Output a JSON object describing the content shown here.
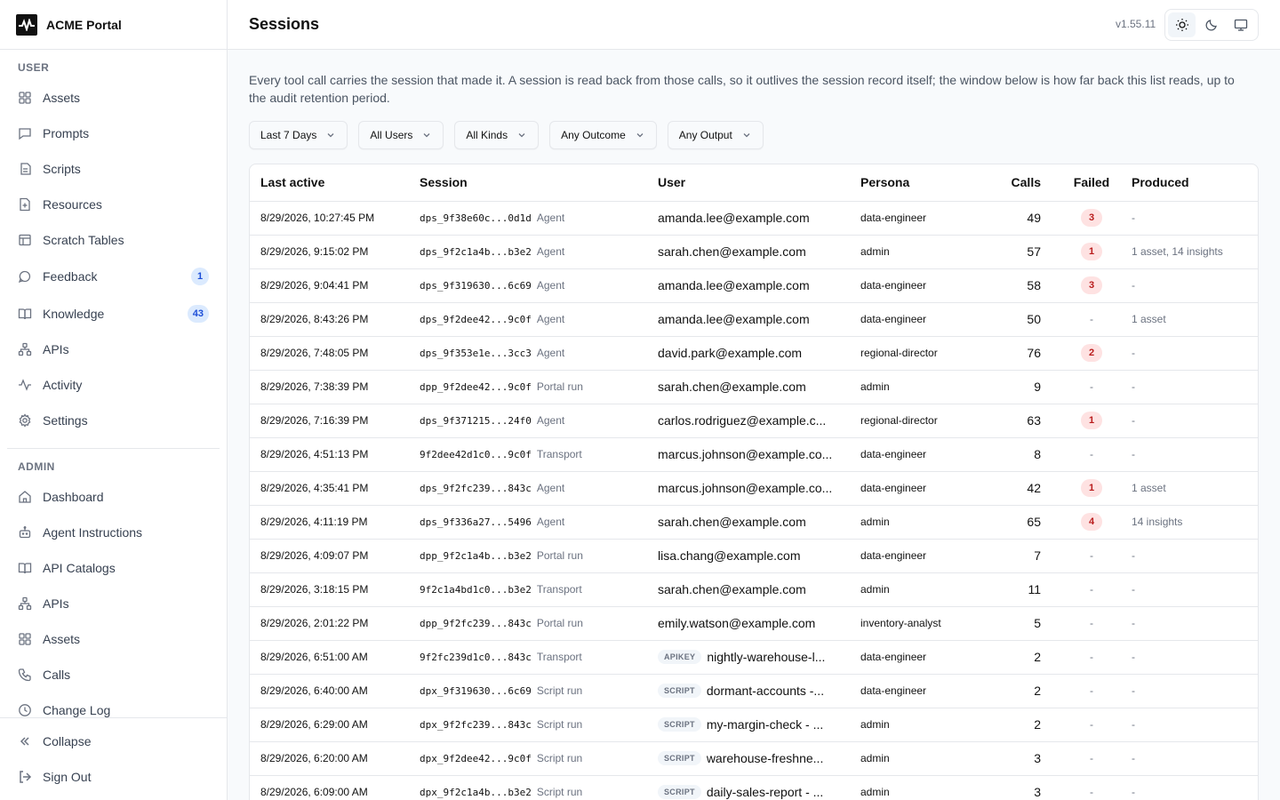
{
  "app": {
    "name": "ACME Portal",
    "version": "v1.55.11"
  },
  "sidebar": {
    "user_section": "USER",
    "admin_section": "ADMIN",
    "user_items": [
      {
        "label": "Assets",
        "icon": "grid-icon"
      },
      {
        "label": "Prompts",
        "icon": "message-square-icon"
      },
      {
        "label": "Scripts",
        "icon": "script-icon"
      },
      {
        "label": "Resources",
        "icon": "file-plus-icon"
      },
      {
        "label": "Scratch Tables",
        "icon": "table-icon"
      },
      {
        "label": "Feedback",
        "icon": "message-circle-icon",
        "badge": "1"
      },
      {
        "label": "Knowledge",
        "icon": "book-open-icon",
        "badge": "43"
      },
      {
        "label": "APIs",
        "icon": "network-icon"
      },
      {
        "label": "Activity",
        "icon": "activity-icon"
      },
      {
        "label": "Settings",
        "icon": "gear-icon"
      }
    ],
    "admin_items": [
      {
        "label": "Dashboard",
        "icon": "home-icon"
      },
      {
        "label": "Agent Instructions",
        "icon": "bot-icon"
      },
      {
        "label": "API Catalogs",
        "icon": "book-open-icon"
      },
      {
        "label": "APIs",
        "icon": "network-icon"
      },
      {
        "label": "Assets",
        "icon": "grid-icon"
      },
      {
        "label": "Calls",
        "icon": "phone-icon"
      },
      {
        "label": "Change Log",
        "icon": "clock-icon"
      }
    ],
    "footer": {
      "collapse": "Collapse",
      "sign_out": "Sign Out"
    }
  },
  "header": {
    "title": "Sessions"
  },
  "intro": "Every tool call carries the session that made it. A session is read back from those calls, so it outlives the session record itself; the window below is how far back this list reads, up to the audit retention period.",
  "filters": [
    "Last 7 Days",
    "All Users",
    "All Kinds",
    "Any Outcome",
    "Any Output"
  ],
  "table": {
    "columns": [
      "Last active",
      "Session",
      "User",
      "Persona",
      "Calls",
      "Failed",
      "Produced"
    ],
    "rows": [
      {
        "time": "8/29/2026, 10:27:45 PM",
        "session": "dps_9f38e60c...0d1d",
        "kind": "Agent",
        "user": "amanda.lee@example.com",
        "tag": "",
        "persona": "data-engineer",
        "calls": "49",
        "failed": "3",
        "produced": "-"
      },
      {
        "time": "8/29/2026, 9:15:02 PM",
        "session": "dps_9f2c1a4b...b3e2",
        "kind": "Agent",
        "user": "sarah.chen@example.com",
        "tag": "",
        "persona": "admin",
        "calls": "57",
        "failed": "1",
        "produced": "1 asset, 14 insights"
      },
      {
        "time": "8/29/2026, 9:04:41 PM",
        "session": "dps_9f319630...6c69",
        "kind": "Agent",
        "user": "amanda.lee@example.com",
        "tag": "",
        "persona": "data-engineer",
        "calls": "58",
        "failed": "3",
        "produced": "-"
      },
      {
        "time": "8/29/2026, 8:43:26 PM",
        "session": "dps_9f2dee42...9c0f",
        "kind": "Agent",
        "user": "amanda.lee@example.com",
        "tag": "",
        "persona": "data-engineer",
        "calls": "50",
        "failed": "-",
        "produced": "1 asset"
      },
      {
        "time": "8/29/2026, 7:48:05 PM",
        "session": "dps_9f353e1e...3cc3",
        "kind": "Agent",
        "user": "david.park@example.com",
        "tag": "",
        "persona": "regional-director",
        "calls": "76",
        "failed": "2",
        "produced": "-"
      },
      {
        "time": "8/29/2026, 7:38:39 PM",
        "session": "dpp_9f2dee42...9c0f",
        "kind": "Portal run",
        "user": "sarah.chen@example.com",
        "tag": "",
        "persona": "admin",
        "calls": "9",
        "failed": "-",
        "produced": "-"
      },
      {
        "time": "8/29/2026, 7:16:39 PM",
        "session": "dps_9f371215...24f0",
        "kind": "Agent",
        "user": "carlos.rodriguez@example.c...",
        "tag": "",
        "persona": "regional-director",
        "calls": "63",
        "failed": "1",
        "produced": "-"
      },
      {
        "time": "8/29/2026, 4:51:13 PM",
        "session": "9f2dee42d1c0...9c0f",
        "kind": "Transport",
        "user": "marcus.johnson@example.co...",
        "tag": "",
        "persona": "data-engineer",
        "calls": "8",
        "failed": "-",
        "produced": "-"
      },
      {
        "time": "8/29/2026, 4:35:41 PM",
        "session": "dps_9f2fc239...843c",
        "kind": "Agent",
        "user": "marcus.johnson@example.co...",
        "tag": "",
        "persona": "data-engineer",
        "calls": "42",
        "failed": "1",
        "produced": "1 asset"
      },
      {
        "time": "8/29/2026, 4:11:19 PM",
        "session": "dps_9f336a27...5496",
        "kind": "Agent",
        "user": "sarah.chen@example.com",
        "tag": "",
        "persona": "admin",
        "calls": "65",
        "failed": "4",
        "produced": "14 insights"
      },
      {
        "time": "8/29/2026, 4:09:07 PM",
        "session": "dpp_9f2c1a4b...b3e2",
        "kind": "Portal run",
        "user": "lisa.chang@example.com",
        "tag": "",
        "persona": "data-engineer",
        "calls": "7",
        "failed": "-",
        "produced": "-"
      },
      {
        "time": "8/29/2026, 3:18:15 PM",
        "session": "9f2c1a4bd1c0...b3e2",
        "kind": "Transport",
        "user": "sarah.chen@example.com",
        "tag": "",
        "persona": "admin",
        "calls": "11",
        "failed": "-",
        "produced": "-"
      },
      {
        "time": "8/29/2026, 2:01:22 PM",
        "session": "dpp_9f2fc239...843c",
        "kind": "Portal run",
        "user": "emily.watson@example.com",
        "tag": "",
        "persona": "inventory-analyst",
        "calls": "5",
        "failed": "-",
        "produced": "-"
      },
      {
        "time": "8/29/2026, 6:51:00 AM",
        "session": "9f2fc239d1c0...843c",
        "kind": "Transport",
        "user": "nightly-warehouse-l...",
        "tag": "APIKEY",
        "persona": "data-engineer",
        "calls": "2",
        "failed": "-",
        "produced": "-"
      },
      {
        "time": "8/29/2026, 6:40:00 AM",
        "session": "dpx_9f319630...6c69",
        "kind": "Script run",
        "user": "dormant-accounts -...",
        "tag": "SCRIPT",
        "persona": "data-engineer",
        "calls": "2",
        "failed": "-",
        "produced": "-"
      },
      {
        "time": "8/29/2026, 6:29:00 AM",
        "session": "dpx_9f2fc239...843c",
        "kind": "Script run",
        "user": "my-margin-check - ...",
        "tag": "SCRIPT",
        "persona": "admin",
        "calls": "2",
        "failed": "-",
        "produced": "-"
      },
      {
        "time": "8/29/2026, 6:20:00 AM",
        "session": "dpx_9f2dee42...9c0f",
        "kind": "Script run",
        "user": "warehouse-freshne...",
        "tag": "SCRIPT",
        "persona": "admin",
        "calls": "3",
        "failed": "-",
        "produced": "-"
      },
      {
        "time": "8/29/2026, 6:09:00 AM",
        "session": "dpx_9f2c1a4b...b3e2",
        "kind": "Script run",
        "user": "daily-sales-report - ...",
        "tag": "SCRIPT",
        "persona": "admin",
        "calls": "3",
        "failed": "-",
        "produced": "-"
      }
    ]
  },
  "colors": {
    "badge_blue_bg": "#dbeafe",
    "badge_blue_text": "#1d4ed8",
    "fail_bg": "#fee2e2",
    "fail_text": "#b91c1c"
  }
}
